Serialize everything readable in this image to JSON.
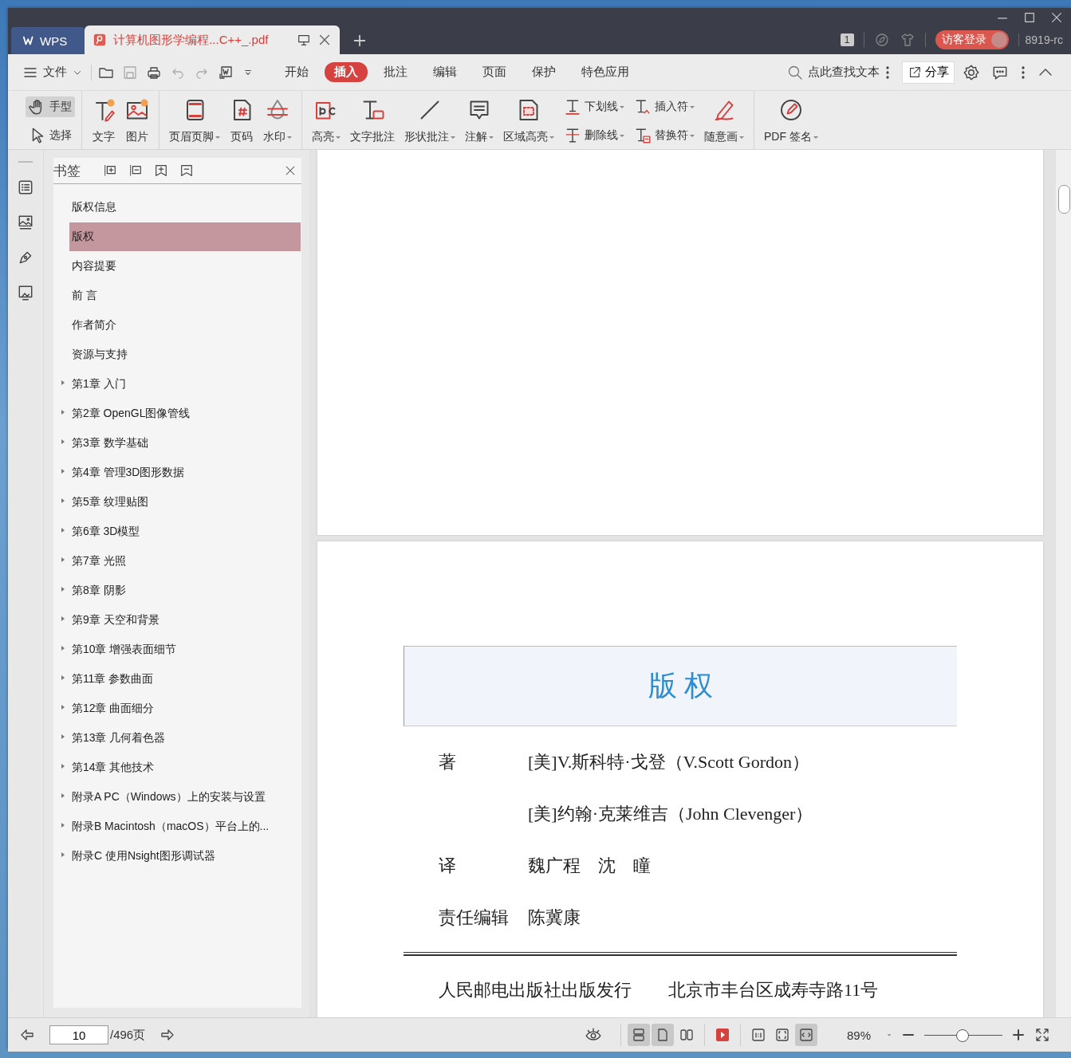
{
  "title_bar": {
    "app_tab": "WPS",
    "doc_tab": {
      "title": "计算机图形学编程...C++_.pdf",
      "selected": true
    },
    "page_badge": "1",
    "login_button": "访客登录",
    "user_name": "8919-rc"
  },
  "menu_bar": {
    "file_menu": "文件",
    "tabs": [
      {
        "label": "开始",
        "selected": false
      },
      {
        "label": "插入",
        "selected": true
      },
      {
        "label": "批注",
        "selected": false
      },
      {
        "label": "编辑",
        "selected": false
      },
      {
        "label": "页面",
        "selected": false
      },
      {
        "label": "保护",
        "selected": false
      },
      {
        "label": "特色应用",
        "selected": false
      }
    ],
    "search": {
      "placeholder": "点此查找文本"
    },
    "share_button": "分享"
  },
  "toolbar": {
    "groups": [
      {
        "items": [
          {
            "kind": "stack",
            "items": [
              {
                "label": "手型",
                "selected": true,
                "dropdown": false
              },
              {
                "label": "选择",
                "selected": false,
                "dropdown": false
              }
            ]
          }
        ]
      },
      {
        "items": [
          {
            "kind": "big",
            "label": "文字",
            "dropdown": false
          },
          {
            "kind": "big",
            "label": "图片",
            "dropdown": false
          }
        ]
      },
      {
        "items": [
          {
            "kind": "big",
            "label": "页眉页脚",
            "dropdown": true
          },
          {
            "kind": "big",
            "label": "页码",
            "dropdown": false
          },
          {
            "kind": "big",
            "label": "水印",
            "dropdown": true
          }
        ]
      },
      {
        "items": [
          {
            "kind": "big",
            "label": "高亮",
            "dropdown": true
          },
          {
            "kind": "big",
            "label": "文字批注",
            "dropdown": false
          },
          {
            "kind": "big",
            "label": "形状批注",
            "dropdown": true
          },
          {
            "kind": "big",
            "label": "注解",
            "dropdown": true
          },
          {
            "kind": "big",
            "label": "区域高亮",
            "dropdown": true
          },
          {
            "kind": "stack",
            "items": [
              {
                "label": "下划线",
                "selected": false,
                "dropdown": true
              },
              {
                "label": "删除线",
                "selected": false,
                "dropdown": true
              }
            ]
          },
          {
            "kind": "stack",
            "items": [
              {
                "label": "插入符",
                "selected": false,
                "dropdown": true
              },
              {
                "label": "替换符",
                "selected": false,
                "dropdown": true
              }
            ]
          },
          {
            "kind": "big",
            "label": "随意画",
            "dropdown": true
          }
        ]
      },
      {
        "items": [
          {
            "kind": "big",
            "label": "PDF 签名",
            "dropdown": true
          }
        ]
      }
    ]
  },
  "sidebar": {
    "title": "书签",
    "items": [
      {
        "label": "版权信息",
        "selected": false,
        "collapsed": false
      },
      {
        "label": "版权",
        "selected": true,
        "collapsed": false
      },
      {
        "label": "内容提要",
        "selected": false,
        "collapsed": false
      },
      {
        "label": "前 言",
        "selected": false,
        "collapsed": false
      },
      {
        "label": "作者简介",
        "selected": false,
        "collapsed": false
      },
      {
        "label": "资源与支持",
        "selected": false,
        "collapsed": false
      },
      {
        "label": "第1章 入门",
        "selected": false,
        "collapsed": true
      },
      {
        "label": "第2章 OpenGL图像管线",
        "selected": false,
        "collapsed": true
      },
      {
        "label": "第3章 数学基础",
        "selected": false,
        "collapsed": true
      },
      {
        "label": "第4章 管理3D图形数据",
        "selected": false,
        "collapsed": true
      },
      {
        "label": "第5章 纹理贴图",
        "selected": false,
        "collapsed": true
      },
      {
        "label": "第6章 3D模型",
        "selected": false,
        "collapsed": true
      },
      {
        "label": "第7章 光照",
        "selected": false,
        "collapsed": true
      },
      {
        "label": "第8章 阴影",
        "selected": false,
        "collapsed": true
      },
      {
        "label": "第9章 天空和背景",
        "selected": false,
        "collapsed": true
      },
      {
        "label": "第10章 增强表面细节",
        "selected": false,
        "collapsed": true
      },
      {
        "label": "第11章 参数曲面",
        "selected": false,
        "collapsed": true
      },
      {
        "label": "第12章 曲面细分",
        "selected": false,
        "collapsed": true
      },
      {
        "label": "第13章 几何着色器",
        "selected": false,
        "collapsed": true
      },
      {
        "label": "第14章 其他技术",
        "selected": false,
        "collapsed": true
      },
      {
        "label": "附录A PC（Windows）上的安装与设置",
        "selected": false,
        "collapsed": true
      },
      {
        "label": "附录B Macintosh（macOS）平台上的...",
        "selected": false,
        "collapsed": true
      },
      {
        "label": "附录C 使用Nsight图形调试器",
        "selected": false,
        "collapsed": true
      }
    ]
  },
  "document": {
    "pages": [
      {
        "kind": "blank"
      },
      {
        "kind": "copyright",
        "heading": "版 权",
        "credits": [
          {
            "role": "著",
            "names": "[美]V.斯科特·戈登（V.Scott Gordon）"
          },
          {
            "names": "[美]约翰·克莱维吉（John Clevenger）"
          },
          {
            "role": "译",
            "names": "魏广程　沈　瞳"
          },
          {
            "role": "责任编辑",
            "names": "陈冀康"
          }
        ],
        "publisher": "人民邮电出版社出版发行",
        "address": "北京市丰台区成寿寺路11号"
      }
    ]
  },
  "status_bar": {
    "page_input": "10",
    "page_total": "/496页",
    "view_modes": [
      {
        "selected": true
      },
      {
        "selected": true
      },
      {
        "selected": false
      }
    ],
    "fit_modes": [
      {
        "selected": false
      },
      {
        "selected": false
      },
      {
        "selected": true
      }
    ],
    "zoom": "89%",
    "zoom_slider": {
      "level": 0.49
    }
  }
}
